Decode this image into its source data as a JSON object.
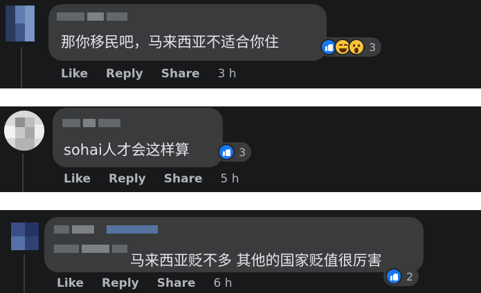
{
  "comments": [
    {
      "text": "那你移民吧，马来西亚不适合你住",
      "reaction_count": "3",
      "reactions": [
        "like-icon",
        "haha-icon",
        "wow-icon"
      ],
      "actions": {
        "like": "Like",
        "reply": "Reply",
        "share": "Share"
      },
      "time": "3 h"
    },
    {
      "text": "sohai人才会这样算",
      "reaction_count": "3",
      "reactions": [
        "like-icon"
      ],
      "actions": {
        "like": "Like",
        "reply": "Reply",
        "share": "Share"
      },
      "time": "5 h"
    },
    {
      "text": "马来西亚贬不多 其他的国家贬值很厉害",
      "reaction_count": "2",
      "reactions": [
        "like-icon"
      ],
      "actions": {
        "like": "Like",
        "reply": "Reply",
        "share": "Share"
      },
      "time": "6 h"
    }
  ],
  "colors": {
    "background": "#18191a",
    "bubble": "#3a3b3c",
    "text": "#e4e6eb",
    "secondary_text": "#b0b3b8",
    "like_blue": "#1877f2",
    "emoji_yellow": "#f7c439"
  }
}
